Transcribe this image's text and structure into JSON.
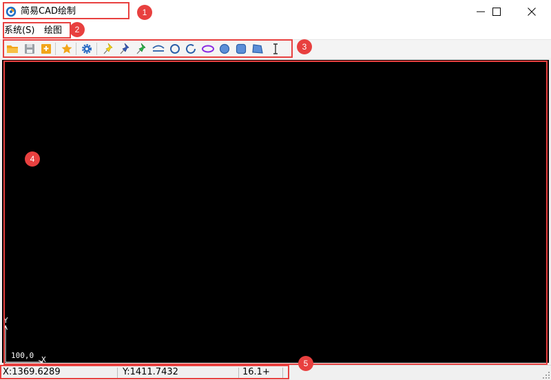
{
  "window": {
    "title": "简易CAD绘制",
    "icon": "cad-app-logo-icon",
    "controls": [
      "minimize-icon",
      "maximize-icon",
      "close-icon"
    ]
  },
  "menu": {
    "items": [
      {
        "label": "系统(S)"
      },
      {
        "label": "绘图"
      }
    ]
  },
  "toolbar": {
    "buttons": [
      {
        "icon": "open-folder-icon",
        "color": "#f2a51a"
      },
      {
        "icon": "save-disk-icon",
        "color": "#9aa0a6"
      },
      {
        "icon": "save-as-icon",
        "color": "#f2a51a"
      },
      {
        "icon": "star-icon",
        "color": "#f2a51a"
      },
      {
        "icon": "gear-icon",
        "color": "#2b6cc4"
      },
      {
        "icon": "yellow-pin-icon",
        "color": "#f2d21b"
      },
      {
        "icon": "blue-pin-icon",
        "color": "#3b5bb5"
      },
      {
        "icon": "green-pin-icon",
        "color": "#2db24a"
      },
      {
        "icon": "arc-line-icon",
        "color": "#2b5fa8"
      },
      {
        "icon": "circle-outline-icon",
        "color": "#2b5fa8"
      },
      {
        "icon": "arc-icon",
        "color": "#2b5fa8"
      },
      {
        "icon": "ellipse-icon",
        "color": "#8a2be2"
      },
      {
        "icon": "filled-circle-icon",
        "color": "#5b8ed8"
      },
      {
        "icon": "filled-rectangle-icon",
        "color": "#5b8ed8"
      },
      {
        "icon": "polygon-icon",
        "color": "#5b8ed8"
      },
      {
        "icon": "text-cursor-icon",
        "color": "#333333"
      }
    ]
  },
  "canvas": {
    "background": "#000000",
    "axis": {
      "y_label": "Y",
      "x_label": "X",
      "origin_label": "100,0"
    }
  },
  "status": {
    "x": "X:1369.6289",
    "y": "Y:1411.7432",
    "zoom": "16.1+"
  },
  "annotations": [
    {
      "label": "1"
    },
    {
      "label": "2"
    },
    {
      "label": "3"
    },
    {
      "label": "4"
    },
    {
      "label": "5"
    }
  ],
  "colors": {
    "annotation": "#e8403f",
    "accent_blue": "#2b6cc4"
  }
}
